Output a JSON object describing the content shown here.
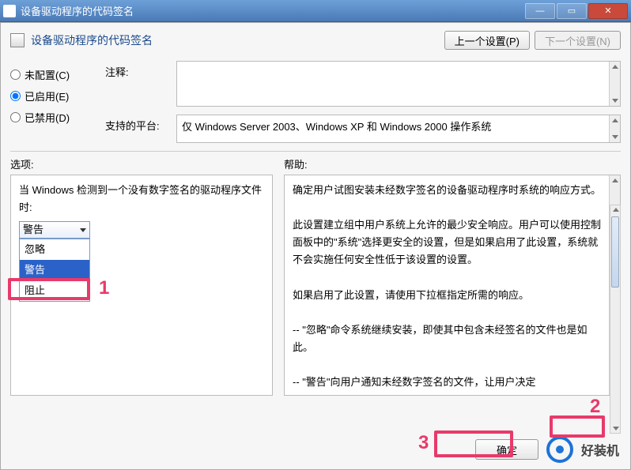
{
  "titlebar": {
    "title": "设备驱动程序的代码签名"
  },
  "header": {
    "title": "设备驱动程序的代码签名",
    "prev_btn": "上一个设置(P)",
    "next_btn": "下一个设置(N)"
  },
  "radios": {
    "not_configured": "未配置(C)",
    "enabled": "已启用(E)",
    "disabled": "已禁用(D)",
    "selected": "enabled"
  },
  "fields": {
    "comment_label": "注释:",
    "comment_value": "",
    "platform_label": "支持的平台:",
    "platform_value": "仅 Windows Server 2003、Windows XP 和 Windows 2000 操作系统"
  },
  "options": {
    "title": "选项:",
    "prompt": "当 Windows 检测到一个没有数字签名的驱动程序文件时:",
    "selected": "警告",
    "items": [
      "忽略",
      "警告",
      "阻止"
    ]
  },
  "help": {
    "title": "帮助:",
    "paragraphs": [
      "确定用户试图安装未经数字签名的设备驱动程序时系统的响应方式。",
      "此设置建立组中用户系统上允许的最少安全响应。用户可以使用控制面板中的\"系统\"选择更安全的设置，但是如果启用了此设置，系统就不会实施任何安全性低于该设置的设置。",
      "如果启用了此设置，请使用下拉框指定所需的响应。",
      "-- \"忽略\"命令系统继续安装，即使其中包含未经签名的文件也是如此。",
      "-- \"警告\"向用户通知未经数字签名的文件，让用户决定"
    ]
  },
  "buttons": {
    "ok": "确定"
  },
  "annotations": {
    "l1": "1",
    "l2": "2",
    "l3": "3"
  },
  "watermark": {
    "text": "好装机"
  }
}
